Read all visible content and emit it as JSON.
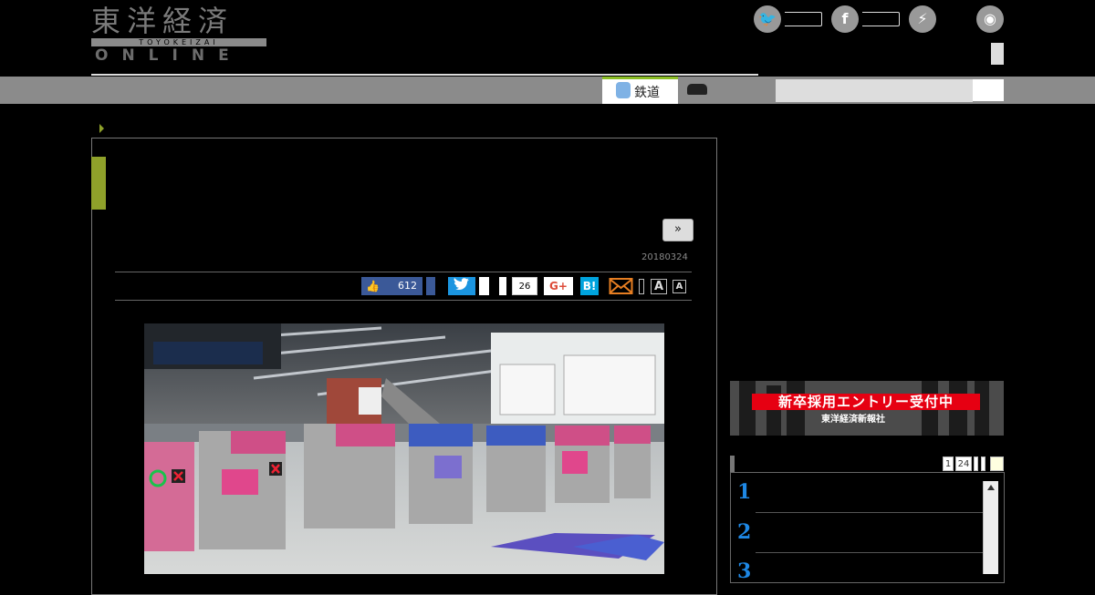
{
  "header": {
    "logo_main": "東洋経済",
    "logo_sub": "TOYOKEIZAI",
    "logo_online": "ONLINE",
    "sns": [
      {
        "name": "twitter",
        "glyph": "🐦"
      },
      {
        "name": "facebook",
        "glyph": "f"
      },
      {
        "name": "messenger",
        "glyph": "⚡"
      },
      {
        "name": "rss",
        "glyph": "◉"
      }
    ]
  },
  "nav": {
    "tabs": [
      {
        "label": "鉄道",
        "icon": "train-icon"
      },
      {
        "label": "",
        "icon": "car-icon"
      }
    ],
    "search_placeholder": ""
  },
  "article": {
    "next_label": "»",
    "date": "20180324",
    "share": {
      "like_count": "612",
      "comment_count": "26",
      "gplus_label": "G+",
      "hatena_label": "B!",
      "font_large": "A",
      "font_small": "A"
    },
    "photo_alt": "station ticket gates"
  },
  "sidebar": {
    "banner_title": "新卒採用エントリー受付中",
    "banner_sub": "東洋経済新報社",
    "ranking_pages": [
      "1",
      "24"
    ],
    "ranking_numbers": [
      "1",
      "2",
      "3"
    ]
  },
  "colors": {
    "accent_green": "#8fa12a",
    "facebook": "#3b5998",
    "twitter": "#1b95e0",
    "hatena": "#00a4de",
    "banner_red": "#e60012"
  }
}
